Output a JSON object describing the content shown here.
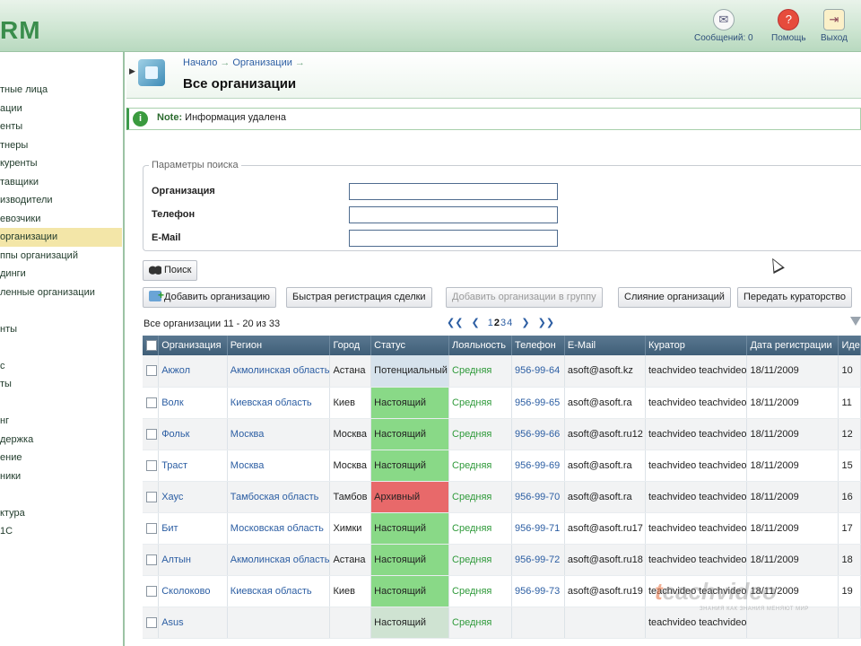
{
  "app": {
    "logo": "RM"
  },
  "top_actions": [
    {
      "label": "Сообщений: 0",
      "icon": "envelope-icon"
    },
    {
      "label": "Помощь",
      "icon": "help-icon"
    },
    {
      "label": "Выход",
      "icon": "exit-icon"
    }
  ],
  "sidebar": {
    "items": [
      {
        "label": "тные лица"
      },
      {
        "label": "ации"
      },
      {
        "label": "енты"
      },
      {
        "label": "тнеры"
      },
      {
        "label": "куренты"
      },
      {
        "label": "тавщики"
      },
      {
        "label": "изводители"
      },
      {
        "label": "евозчики"
      },
      {
        "label": "организации",
        "active": true
      },
      {
        "label": "ппы организаций"
      },
      {
        "label": "динги"
      },
      {
        "label": "ленные организации"
      },
      {
        "label": ""
      },
      {
        "label": "нты"
      },
      {
        "label": ""
      },
      {
        "label": "с"
      },
      {
        "label": "ты"
      },
      {
        "label": ""
      },
      {
        "label": "нг"
      },
      {
        "label": "держка"
      },
      {
        "label": "ение"
      },
      {
        "label": "ники"
      },
      {
        "label": ""
      },
      {
        "label": "ктура"
      },
      {
        "label": "1С"
      }
    ]
  },
  "breadcrumb": {
    "items": [
      "Начало",
      "Организации"
    ],
    "sep": "→"
  },
  "page_title": "Все организации",
  "note": {
    "label": "Note:",
    "text": "Информация удалена",
    "icon": "info-icon"
  },
  "search_params": {
    "legend": "Параметры поиска",
    "fields": [
      {
        "label": "Организация",
        "value": ""
      },
      {
        "label": "Телефон",
        "value": ""
      },
      {
        "label": "E-Mail",
        "value": ""
      }
    ]
  },
  "buttons": {
    "search": "Поиск",
    "add_org": "Добавить организацию",
    "quick_reg": "Быстрая регистрация сделки",
    "add_to_group": "Добавить организации в группу",
    "merge": "Слияние организаций",
    "transfer": "Передать кураторство"
  },
  "list": {
    "info": "Все организации 11 - 20 из 33",
    "pager": {
      "first": "❮❮",
      "prev": "❮",
      "pages": [
        "1",
        "2",
        "3",
        "4"
      ],
      "current": "2",
      "next": "❯",
      "last": "❯❯"
    }
  },
  "table": {
    "columns": [
      "Организация",
      "Регион",
      "Город",
      "Статус",
      "Лояльность",
      "Телефон",
      "E-Mail",
      "Куратор",
      "Дата регистрации",
      "Иде"
    ],
    "rows": [
      {
        "org": "Акжол",
        "region": "Акмолинская область",
        "city": "Астана",
        "status": "Потенциальный",
        "status_key": "potential",
        "loyalty": "Средняя",
        "phone": "956-99-64",
        "email": "asoft@asoft.kz",
        "curator": "teachvideo teachvideo",
        "date": "18/11/2009",
        "id": "10"
      },
      {
        "org": "Волк",
        "region": "Киевская область",
        "city": "Киев",
        "status": "Настоящий",
        "status_key": "current",
        "loyalty": "Средняя",
        "phone": "956-99-65",
        "email": "asoft@asoft.ra",
        "curator": "teachvideo teachvideo",
        "date": "18/11/2009",
        "id": "11"
      },
      {
        "org": "Фольк",
        "region": "Москва",
        "city": "Москва",
        "status": "Настоящий",
        "status_key": "current",
        "loyalty": "Средняя",
        "phone": "956-99-66",
        "email": "asoft@asoft.ru12",
        "curator": "teachvideo teachvideo",
        "date": "18/11/2009",
        "id": "12"
      },
      {
        "org": "Траст",
        "region": "Москва",
        "city": "Москва",
        "status": "Настоящий",
        "status_key": "current",
        "loyalty": "Средняя",
        "phone": "956-99-69",
        "email": "asoft@asoft.ra",
        "curator": "teachvideo teachvideo",
        "date": "18/11/2009",
        "id": "15"
      },
      {
        "org": "Хаус",
        "region": "Тамбоская область",
        "city": "Тамбов",
        "status": "Архивный",
        "status_key": "archived",
        "loyalty": "Средняя",
        "phone": "956-99-70",
        "email": "asoft@asoft.ra",
        "curator": "teachvideo teachvideo",
        "date": "18/11/2009",
        "id": "16"
      },
      {
        "org": "Бит",
        "region": "Московская область",
        "city": "Химки",
        "status": "Настоящий",
        "status_key": "current",
        "loyalty": "Средняя",
        "phone": "956-99-71",
        "email": "asoft@asoft.ru17",
        "curator": "teachvideo teachvideo",
        "date": "18/11/2009",
        "id": "17"
      },
      {
        "org": "Алтын",
        "region": "Акмолинская область",
        "city": "Астана",
        "status": "Настоящий",
        "status_key": "current",
        "loyalty": "Средняя",
        "phone": "956-99-72",
        "email": "asoft@asoft.ru18",
        "curator": "teachvideo teachvideo",
        "date": "18/11/2009",
        "id": "18"
      },
      {
        "org": "Сколоково",
        "region": "Киевская область",
        "city": "Киев",
        "status": "Настоящий",
        "status_key": "current",
        "loyalty": "Средняя",
        "phone": "956-99-73",
        "email": "asoft@asoft.ru19",
        "curator": "teachvideo teachvideo",
        "date": "18/11/2009",
        "id": "19"
      },
      {
        "org": "Asus",
        "region": "",
        "city": "",
        "status": "Настоящий",
        "status_key": "current",
        "loyalty": "Средняя",
        "phone": "",
        "email": "",
        "curator": "teachvideo teachvideo",
        "date": "",
        "id": ""
      }
    ]
  },
  "watermark": {
    "mark": "t",
    "text": "eachvideo",
    "sub": "ЗНАНИЯ КАК ЗНАНИЯ МЕНЯЮТ МИР"
  }
}
